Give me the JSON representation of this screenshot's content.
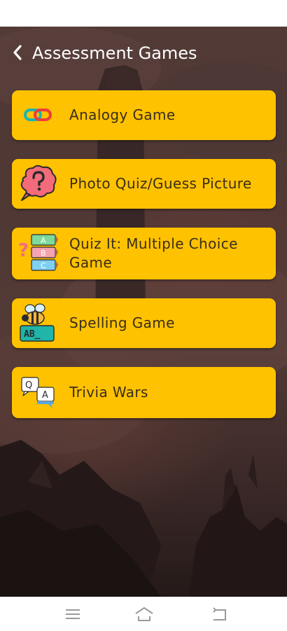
{
  "header": {
    "title": "Assessment Games",
    "back_icon": "chevron-left-icon"
  },
  "games": [
    {
      "label": "Analogy Game",
      "icon": "linked-rings-icon"
    },
    {
      "label": "Photo Quiz/Guess Picture",
      "icon": "question-bubble-icon"
    },
    {
      "label": "Quiz It: Multiple Choice Game",
      "icon": "abc-choices-icon",
      "choices": [
        "A",
        "B",
        "C"
      ]
    },
    {
      "label": "Spelling Game",
      "icon": "bee-letters-icon",
      "tiles": "AB_"
    },
    {
      "label": "Trivia Wars",
      "icon": "qa-chat-icon",
      "q": "Q",
      "a": "A"
    }
  ],
  "nav": {
    "menu_icon": "menu-icon",
    "home_icon": "home-icon",
    "back_icon": "back-icon"
  },
  "colors": {
    "card": "#ffc200",
    "card_text": "#3a2d1a",
    "title": "#ffffff"
  }
}
